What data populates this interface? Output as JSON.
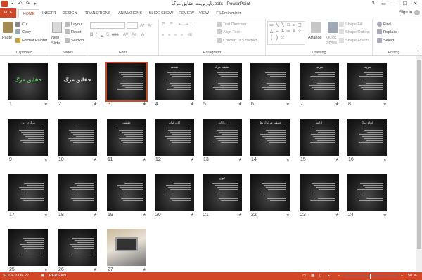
{
  "titlebar": {
    "title": "پاورپوینت حقایق مرگ.pptx - PowerPoint",
    "controls": [
      "?",
      "▭",
      "–",
      "☐",
      "✕"
    ]
  },
  "tabs": {
    "items": [
      "FILE",
      "HOME",
      "INSERT",
      "DESIGN",
      "TRANSITIONS",
      "ANIMATIONS",
      "SLIDE SHOW",
      "REVIEW",
      "VIEW",
      "FILEminimizer"
    ],
    "active": "HOME",
    "signin": "Sign in"
  },
  "ribbon": {
    "clipboard": {
      "paste": "Paste",
      "cut": "Cut",
      "copy": "Copy",
      "format_painter": "Format Painter",
      "label": "Clipboard"
    },
    "slides": {
      "new_slide": "New",
      "new_slide2": "Slide",
      "layout": "Layout",
      "reset": "Reset",
      "section": "Section",
      "label": "Slides"
    },
    "font": {
      "label": "Font"
    },
    "paragraph": {
      "text_direction": "Text Direction",
      "align_text": "Align Text",
      "convert": "Convert to SmartArt",
      "label": "Paragraph"
    },
    "drawing": {
      "arrange": "Arrange",
      "quick_styles": "Quick",
      "quick_styles2": "Styles",
      "shape_fill": "Shape Fill",
      "shape_outline": "Shape Outline",
      "shape_effects": "Shape Effects",
      "label": "Drawing"
    },
    "editing": {
      "find": "Find",
      "replace": "Replace",
      "select": "Select",
      "label": "Editing"
    }
  },
  "slides": [
    {
      "num": "1",
      "title": "حقایق مرگ"
    },
    {
      "num": "2",
      "title": "حقایق مرگ"
    },
    {
      "num": "3",
      "title": "",
      "selected": true
    },
    {
      "num": "4",
      "title": "مقدمه"
    },
    {
      "num": "5",
      "title": "حقیقت مرگ"
    },
    {
      "num": "6",
      "title": ""
    },
    {
      "num": "7",
      "title": "تعریف"
    },
    {
      "num": "8",
      "title": "تعریف"
    },
    {
      "num": "9",
      "title": "مرگ در دین"
    },
    {
      "num": "10",
      "title": ""
    },
    {
      "num": "11",
      "title": "حقیقت"
    },
    {
      "num": "12",
      "title": "آیات قرآن"
    },
    {
      "num": "13",
      "title": "روایات"
    },
    {
      "num": "14",
      "title": "حقیقت مرگ از نظر"
    },
    {
      "num": "15",
      "title": "ادامه"
    },
    {
      "num": "16",
      "title": "انواع مرگ"
    },
    {
      "num": "17",
      "title": ""
    },
    {
      "num": "18",
      "title": ""
    },
    {
      "num": "19",
      "title": ""
    },
    {
      "num": "20",
      "title": ""
    },
    {
      "num": "21",
      "title": "انواع"
    },
    {
      "num": "22",
      "title": ""
    },
    {
      "num": "23",
      "title": ""
    },
    {
      "num": "24",
      "title": ""
    },
    {
      "num": "25",
      "title": ""
    },
    {
      "num": "26",
      "title": ""
    },
    {
      "num": "27",
      "title": "",
      "photo": true
    }
  ],
  "status": {
    "slide_of": "SLIDE 3 OF 27",
    "language": "PERSIAN",
    "zoom": "50 %"
  },
  "colors": {
    "accent": "#d24726"
  }
}
